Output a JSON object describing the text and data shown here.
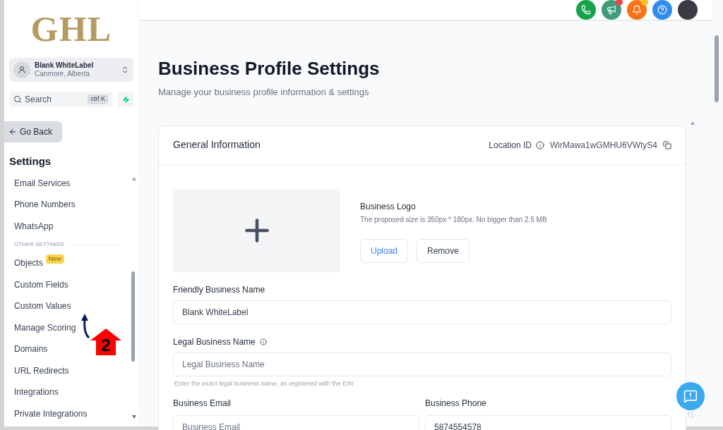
{
  "sidebar": {
    "logo": "GHL",
    "account": {
      "name": "Blank WhiteLabel",
      "location": "Canmore, Alberta"
    },
    "search": {
      "placeholder": "Search",
      "shortcut": "ctrl K"
    },
    "back": "Go Back",
    "heading": "Settings",
    "items": [
      {
        "label": "Email Services",
        "kind": "link"
      },
      {
        "label": "Phone Numbers",
        "kind": "link"
      },
      {
        "label": "WhatsApp",
        "kind": "link"
      },
      {
        "label": "OTHER SETTINGS",
        "kind": "section"
      },
      {
        "label": "Objects",
        "kind": "link",
        "badge": "New"
      },
      {
        "label": "Custom Fields",
        "kind": "link"
      },
      {
        "label": "Custom Values",
        "kind": "link"
      },
      {
        "label": "Manage Scoring",
        "kind": "link"
      },
      {
        "label": "Domains",
        "kind": "link"
      },
      {
        "label": "URL Redirects",
        "kind": "link"
      },
      {
        "label": "Integrations",
        "kind": "link"
      },
      {
        "label": "Private Integrations",
        "kind": "link"
      }
    ]
  },
  "annotation": {
    "step": "2"
  },
  "header_icons": [
    {
      "kind": "phone",
      "dot": false
    },
    {
      "kind": "megaphone",
      "dot": true
    },
    {
      "kind": "bell",
      "dot": true
    },
    {
      "kind": "help",
      "dot": false
    },
    {
      "kind": "avatar",
      "dot": false
    }
  ],
  "page": {
    "title": "Business Profile Settings",
    "subtitle": "Manage your business profile information & settings"
  },
  "card": {
    "title": "General Information",
    "location_label": "Location ID",
    "location_id": "WirMawa1wGMHU6VWtyS4",
    "logo": {
      "label": "Business Logo",
      "hint": "The proposed size is 350px * 180px. No bigger than 2.5 MB",
      "buttons": [
        "Upload",
        "Remove"
      ]
    },
    "fields": [
      {
        "label": "Friendly Business Name",
        "value": "Blank WhiteLabel",
        "info": false
      },
      {
        "label": "Legal Business Name",
        "placeholder": "Legal Business Name",
        "info": true,
        "help": "Enter the exact legal business name, as registered with the EIN"
      }
    ],
    "pair": [
      {
        "label": "Business Email",
        "placeholder": "Business Email"
      },
      {
        "label": "Business Phone",
        "value": "5874554578"
      }
    ]
  }
}
